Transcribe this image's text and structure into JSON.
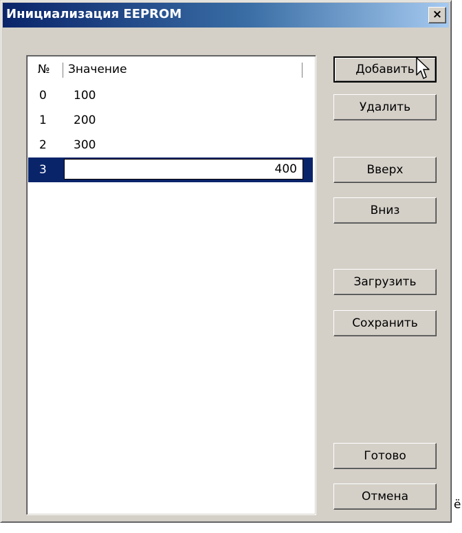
{
  "window": {
    "title": "Инициализация EEPROM",
    "close_symbol": "×"
  },
  "list": {
    "columns": [
      "№",
      "Значение"
    ],
    "rows": [
      {
        "num": "0",
        "value": "100"
      },
      {
        "num": "1",
        "value": "200"
      },
      {
        "num": "2",
        "value": "300"
      },
      {
        "num": "3",
        "value": "400",
        "selected": true
      }
    ]
  },
  "buttons": {
    "add": "Добавить",
    "delete": "Удалить",
    "up": "Вверх",
    "down": "Вниз",
    "load": "Загрузить",
    "save": "Сохранить",
    "done": "Готово",
    "cancel": "Отмена"
  },
  "stray_text": "ё",
  "icons": {
    "cursor": "arrow-cursor-icon",
    "close": "close-icon"
  },
  "colors": {
    "title_start": "#0a246a",
    "title_end": "#a6caf0",
    "selection": "#0a246a",
    "face": "#d4d0c8"
  }
}
